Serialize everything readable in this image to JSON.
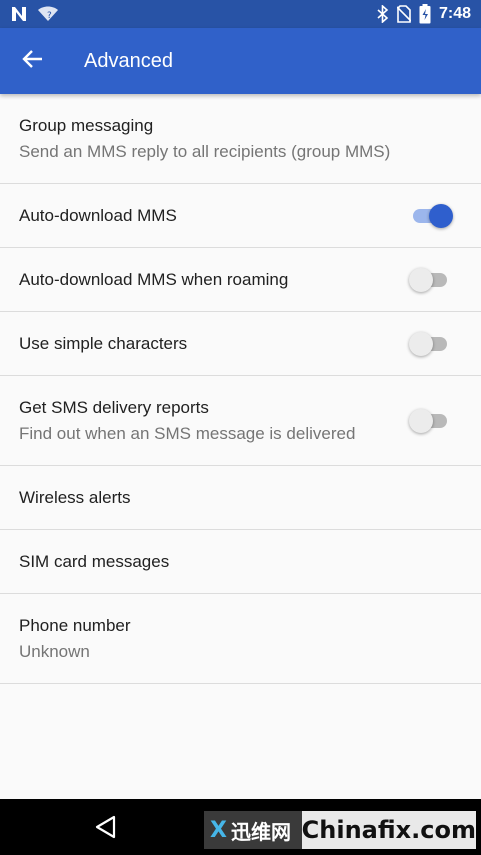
{
  "status_bar": {
    "time": "7:48",
    "icons": [
      "n-notification-icon",
      "wifi-icon",
      "bluetooth-icon",
      "no-sim-icon",
      "battery-icon"
    ]
  },
  "app_bar": {
    "title": "Advanced",
    "back_icon": "arrow-back-icon"
  },
  "settings": {
    "group_messaging": {
      "title": "Group messaging",
      "summary": "Send an MMS reply to all recipients (group MMS)"
    },
    "auto_download_mms": {
      "title": "Auto-download MMS",
      "enabled": true
    },
    "auto_download_roaming": {
      "title": "Auto-download MMS when roaming",
      "enabled": false
    },
    "simple_characters": {
      "title": "Use simple characters",
      "enabled": false
    },
    "delivery_reports": {
      "title": "Get SMS delivery reports",
      "summary": "Find out when an SMS message is delivered",
      "enabled": false
    },
    "wireless_alerts": {
      "title": "Wireless alerts"
    },
    "sim_messages": {
      "title": "SIM card messages"
    },
    "phone_number": {
      "title": "Phone number",
      "summary": "Unknown"
    }
  },
  "navigation_bar": {
    "back_icon": "nav-back-triangle-icon"
  },
  "watermark": {
    "logo_text": "迅维网",
    "site": "Chinafix.com"
  },
  "colors": {
    "status_bar": "#2853a6",
    "app_bar": "#3061c9",
    "accent": "#2f5fcd",
    "accent_track": "#9cb6ec"
  }
}
